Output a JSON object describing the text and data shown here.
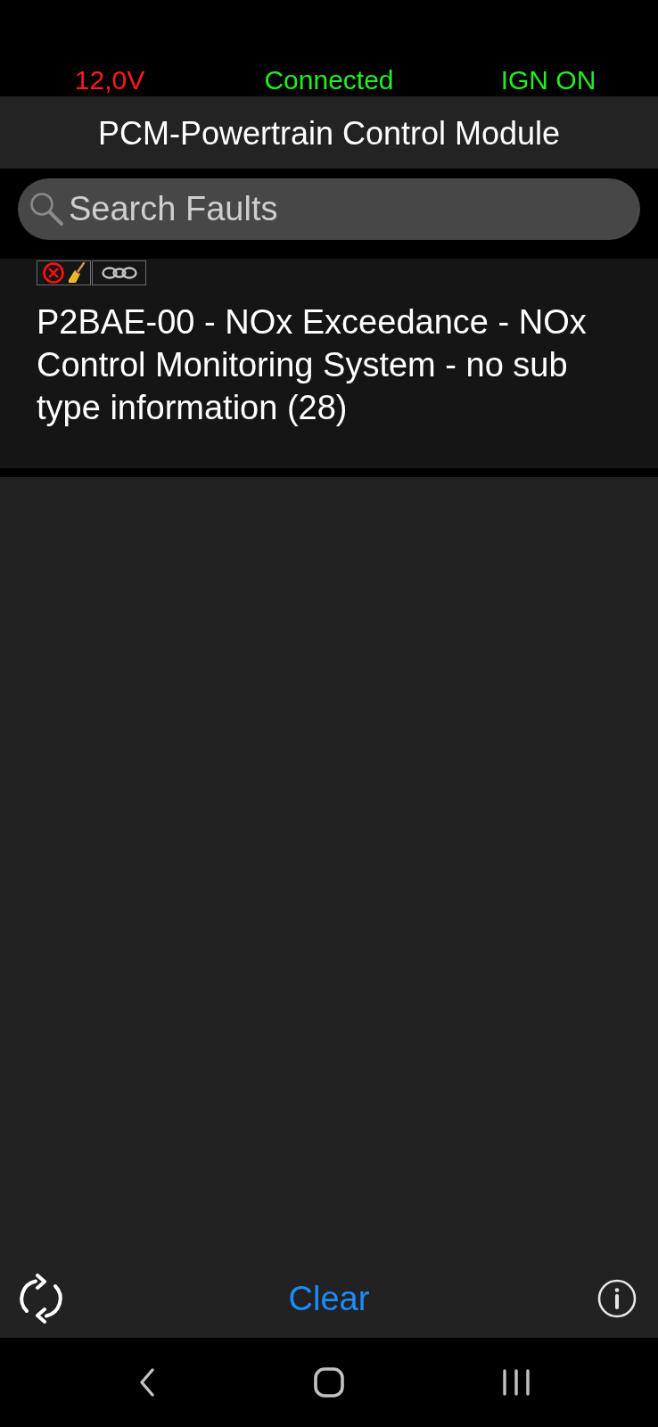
{
  "status": [
    {
      "text": "12,0V",
      "color": "#ff1a1a"
    },
    {
      "text": "Connected",
      "color": "#22ee22"
    },
    {
      "text": "IGN ON",
      "color": "#22ee22"
    }
  ],
  "title": "PCM-Powertrain Control Module",
  "search": {
    "placeholder": "Search Faults"
  },
  "faults": [
    {
      "badges": [
        {
          "kind": "cleared"
        },
        {
          "kind": "linked"
        }
      ],
      "text": "P2BAE-00 - NOx Exceedance - NOx Control Monitoring System - no sub type information (28)"
    }
  ],
  "toolbar": {
    "clear_button": "Clear"
  }
}
